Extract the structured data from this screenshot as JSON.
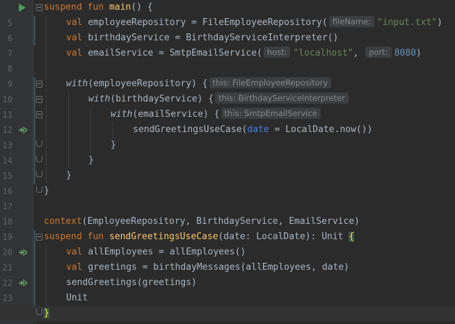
{
  "editor": {
    "lines": [
      {
        "num": "5"
      },
      {
        "num": "6"
      },
      {
        "num": "7"
      },
      {
        "num": "8"
      },
      {
        "num": "9"
      },
      {
        "num": "10"
      },
      {
        "num": "11"
      },
      {
        "num": "12"
      },
      {
        "num": "13"
      },
      {
        "num": "14"
      },
      {
        "num": "15"
      },
      {
        "num": "16"
      },
      {
        "num": "17"
      },
      {
        "num": "18"
      },
      {
        "num": "19"
      },
      {
        "num": "20"
      },
      {
        "num": "21"
      },
      {
        "num": "22"
      },
      {
        "num": "23"
      },
      {
        "num": "24"
      },
      {
        "num": "25"
      }
    ],
    "tokens": {
      "suspend": "suspend",
      "fun": "fun",
      "val": "val",
      "with": "with",
      "main": "main",
      "main_tail": "() {",
      "employeeRepository": "employeeRepository",
      "birthdayService": "birthdayService",
      "emailService": "emailService",
      "eq": " = ",
      "FileEmployeeRepository_call": "FileEmployeeRepository(",
      "BirthdayServiceInterpreter_call": "BirthdayServiceInterpreter()",
      "SmtpEmailService_call": "SmtpEmailService(",
      "input_txt": "\"input.txt\"",
      "localhost": "\"localhost\"",
      "port_val": "8080",
      "comma": ", ",
      "close_paren": ")",
      "with_emp": "(employeeRepository) {",
      "with_bday": "(birthdayService) {",
      "with_email": "(emailService) {",
      "sendGreetingsUseCase_call": "sendGreetingsUseCase(",
      "date_named": "date",
      "named_eq": " = ",
      "localdate_now": "LocalDate.now())",
      "close_brace": "}",
      "context": "context",
      "context_args": "(EmployeeRepository, BirthdayService, EmailService)",
      "sendGreetingsUseCase_decl": "sendGreetingsUseCase",
      "decl_params": "(date: LocalDate): Unit ",
      "open_brace": "{",
      "allEmployees_var": "allEmployees",
      "allEmployees_call": "allEmployees()",
      "greetings_var": "greetings",
      "birthdayMessages_call": "birthdayMessages(allEmployees, date)",
      "sendGreetings_call": "sendGreetings(greetings)",
      "unit": "Unit"
    },
    "hints": {
      "fileName": "fileName:",
      "host": "host:",
      "port": "port:",
      "this_file": "this: FileEmployeeRepository",
      "this_bday": "this: BirthdayServiceInterpreter",
      "this_smtp": "this: SmtpEmailService"
    }
  },
  "icons": {
    "run": "run-gutter-icon",
    "implements": "implements-gutter-icon",
    "fold": "fold-icon"
  },
  "colors": {
    "background": "#2b2b2b",
    "gutter": "#313335",
    "keyword": "#cc7832",
    "function": "#ffc66d",
    "string": "#6a8759",
    "number": "#6897bb",
    "text": "#a9b7c6",
    "hint_bg": "#3b3f41",
    "run_icon": "#499c54"
  }
}
